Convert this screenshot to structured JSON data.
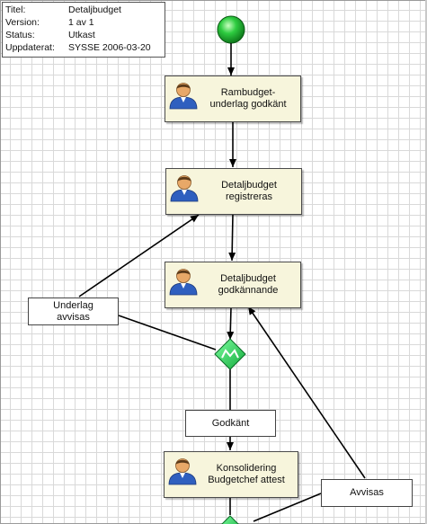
{
  "info": {
    "title_key": "Titel:",
    "title_value": "Detaljbudget",
    "version_key": "Version:",
    "version_value": "1 av 1",
    "status_key": "Status:",
    "status_value": "Utkast",
    "updated_key": "Uppdaterat:",
    "updated_value": "SYSSE  2006-03-20"
  },
  "tasks": [
    {
      "label": "Rambudget-\nunderlag godkänt",
      "icon": "user-icon"
    },
    {
      "label": "Detaljbudget\nregistreras",
      "icon": "user-icon"
    },
    {
      "label": "Detaljbudget\ngodkännande",
      "icon": "user-icon"
    },
    {
      "label": "Konsolidering\nBudgetchef attest",
      "icon": "user-icon"
    }
  ],
  "notes": {
    "rejected_underlag": "Underlag\navvisas",
    "approved": "Godkänt",
    "rejected": "Avvisas"
  },
  "colors": {
    "node_green": "#2ecc40",
    "task_fill": "#f7f5dc"
  }
}
